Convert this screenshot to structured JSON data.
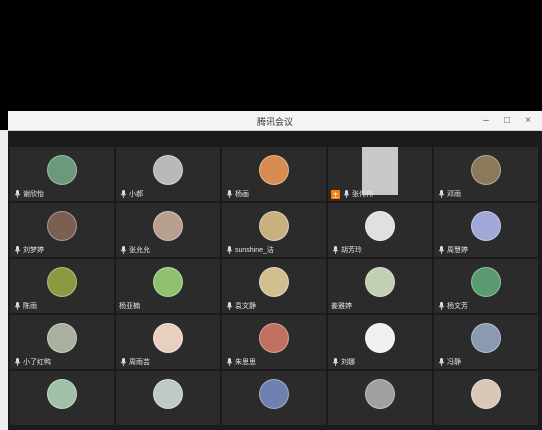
{
  "window": {
    "title": "腾讯会议",
    "controls": {
      "minimize": "–",
      "maximize": "□",
      "close": "×"
    }
  },
  "participants": [
    {
      "name": "谢欣怡",
      "avatar_color": "#6a9a7a",
      "mic": true
    },
    {
      "name": "小郝",
      "avatar_color": "#b9b9b9",
      "mic": true
    },
    {
      "name": "杨画",
      "avatar_color": "#d98c52",
      "mic": true
    },
    {
      "name": "张伟伟",
      "avatar_color": "#c8c8c8",
      "mic": true,
      "host": true,
      "host_label": "主"
    },
    {
      "name": "邓雨",
      "avatar_color": "#8a7a5a",
      "mic": true
    },
    {
      "name": "刘梦婷",
      "avatar_color": "#7a6050",
      "mic": true
    },
    {
      "name": "张允允",
      "avatar_color": "#b8a090",
      "mic": true
    },
    {
      "name": "sunshine_洁",
      "avatar_color": "#c8b080",
      "mic": true
    },
    {
      "name": "胡芳玲",
      "avatar_color": "#e0e0e0",
      "mic": true
    },
    {
      "name": "周慧婷",
      "avatar_color": "#a0a8d8",
      "mic": true
    },
    {
      "name": "陈雨",
      "avatar_color": "#8a9a40",
      "mic": true
    },
    {
      "name": "杨亚楠",
      "avatar_color": "#90c070",
      "mic": false
    },
    {
      "name": "袁文静",
      "avatar_color": "#d0c090",
      "mic": true
    },
    {
      "name": "姜雅婷",
      "avatar_color": "#c0d0b0",
      "mic": false
    },
    {
      "name": "杨文芳",
      "avatar_color": "#5a9a70",
      "mic": true
    },
    {
      "name": "小了红鸭",
      "avatar_color": "#aab0a0",
      "mic": true
    },
    {
      "name": "周雨芸",
      "avatar_color": "#e8d0c0",
      "mic": true
    },
    {
      "name": "朱思思",
      "avatar_color": "#c07060",
      "mic": true
    },
    {
      "name": "刘娜",
      "avatar_color": "#f0f0f0",
      "mic": true
    },
    {
      "name": "冯静",
      "avatar_color": "#8a9ab0",
      "mic": true
    },
    {
      "name": "",
      "avatar_color": "#a0c0a8",
      "mic": false
    },
    {
      "name": "",
      "avatar_color": "#c0c8c8",
      "mic": false
    },
    {
      "name": "",
      "avatar_color": "#7080b0",
      "mic": false
    },
    {
      "name": "",
      "avatar_color": "#a0a0a0",
      "mic": false
    },
    {
      "name": "",
      "avatar_color": "#d8c8b8",
      "mic": false
    }
  ]
}
